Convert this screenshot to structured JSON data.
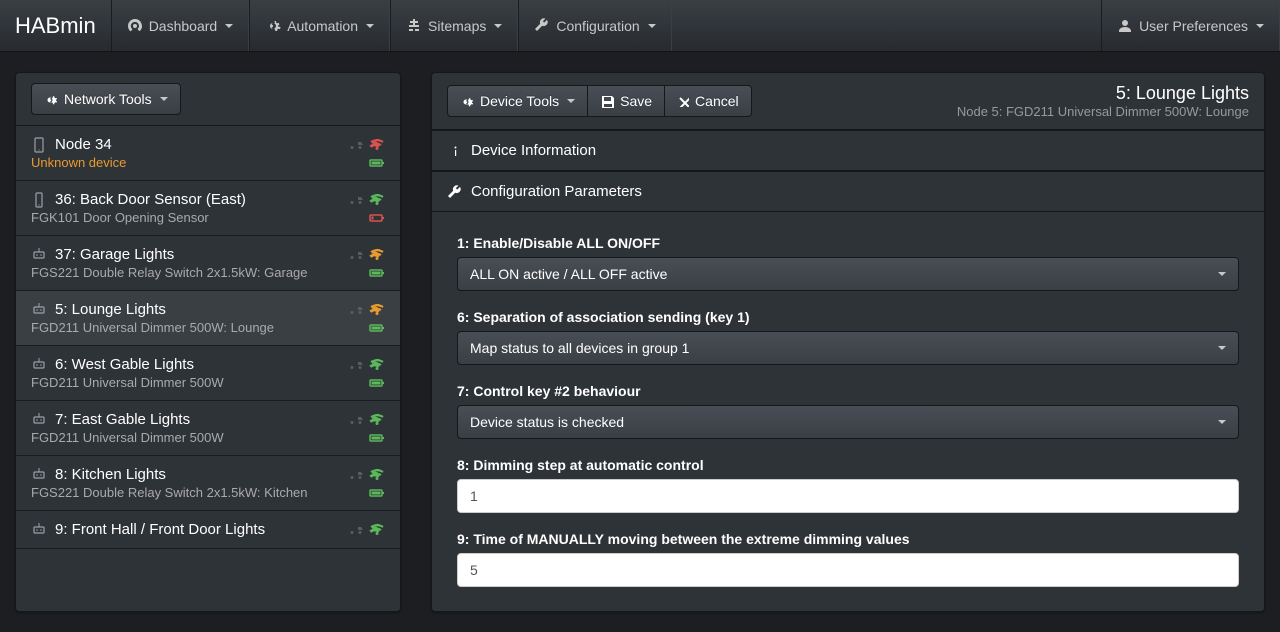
{
  "navbar": {
    "brand": "HABmin",
    "items": [
      {
        "label": "Dashboard"
      },
      {
        "label": "Automation"
      },
      {
        "label": "Sitemaps"
      },
      {
        "label": "Configuration"
      }
    ],
    "user_prefs": "User Preferences"
  },
  "left": {
    "network_tools": "Network Tools",
    "nodes": [
      {
        "title": "Node 34",
        "desc": "Unknown device",
        "unknown": true,
        "signal": "red",
        "batt": "green",
        "devicon": "tablet"
      },
      {
        "title": "36: Back Door Sensor (East)",
        "desc": "FGK101 Door Opening Sensor",
        "signal": "green",
        "batt": "red",
        "devicon": "phone"
      },
      {
        "title": "37: Garage Lights",
        "desc": "FGS221 Double Relay Switch 2x1.5kW: Garage",
        "signal": "orange",
        "batt": "green",
        "devicon": "plug"
      },
      {
        "title": "5: Lounge Lights",
        "desc": "FGD211 Universal Dimmer 500W: Lounge",
        "signal": "orange",
        "batt": "green",
        "selected": true,
        "devicon": "plug"
      },
      {
        "title": "6: West Gable Lights",
        "desc": "FGD211 Universal Dimmer 500W",
        "signal": "green",
        "batt": "green",
        "devicon": "plug"
      },
      {
        "title": "7: East Gable Lights",
        "desc": "FGD211 Universal Dimmer 500W",
        "signal": "green",
        "batt": "green",
        "devicon": "plug"
      },
      {
        "title": "8: Kitchen Lights",
        "desc": "FGS221 Double Relay Switch 2x1.5kW: Kitchen",
        "signal": "green",
        "batt": "green",
        "devicon": "plug"
      },
      {
        "title": "9: Front Hall / Front Door Lights",
        "desc": "",
        "signal": "green",
        "devicon": "plug"
      }
    ]
  },
  "right": {
    "toolbar": {
      "device_tools": "Device Tools",
      "save": "Save",
      "cancel": "Cancel"
    },
    "title": "5: Lounge Lights",
    "subtitle": "Node 5: FGD211 Universal Dimmer 500W: Lounge",
    "sections": {
      "device_info": "Device Information",
      "config_params": "Configuration Parameters"
    },
    "params": [
      {
        "label": "1: Enable/Disable ALL ON/OFF",
        "type": "select",
        "value": "ALL ON active / ALL OFF active"
      },
      {
        "label": "6: Separation of association sending (key 1)",
        "type": "select",
        "value": "Map status to all devices in group 1"
      },
      {
        "label": "7: Control key #2 behaviour",
        "type": "select",
        "value": "Device status is checked"
      },
      {
        "label": "8: Dimming step at automatic control",
        "type": "text",
        "value": "1"
      },
      {
        "label": "9: Time of MANUALLY moving between the extreme dimming values",
        "type": "text",
        "value": "5"
      }
    ]
  }
}
